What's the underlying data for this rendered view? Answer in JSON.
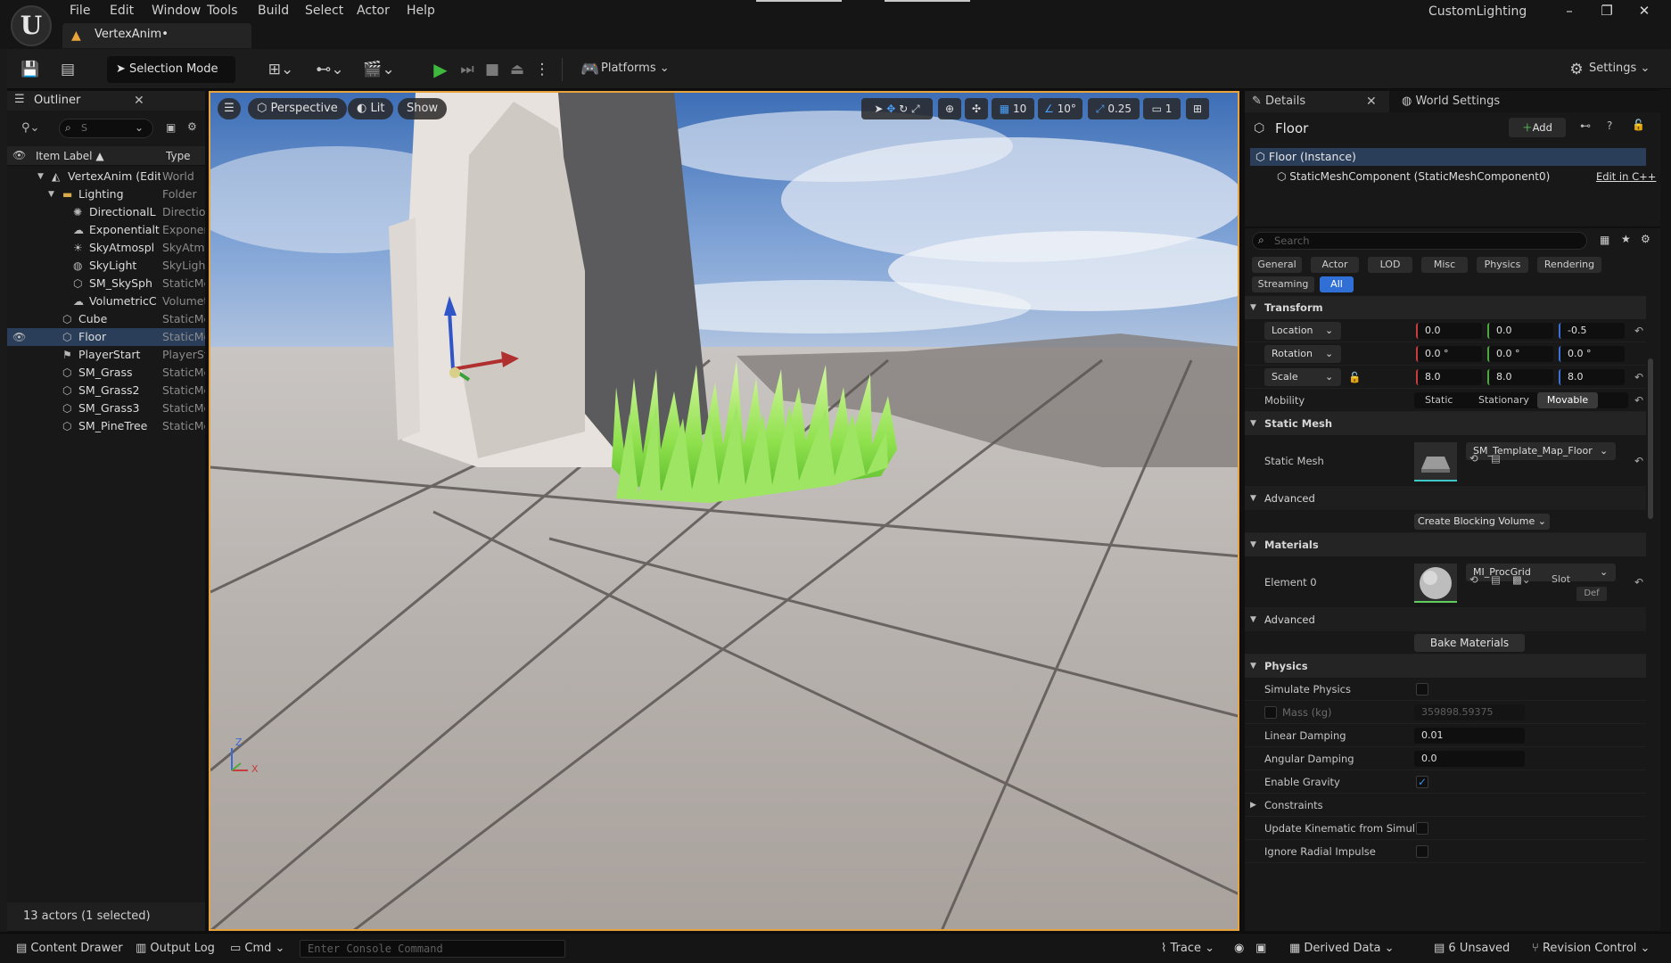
{
  "app": {
    "menu": [
      "File",
      "Edit",
      "Window",
      "Tools",
      "Build",
      "Select",
      "Actor",
      "Help"
    ],
    "document_tab": "VertexAnim•",
    "project_name": "CustomLighting",
    "window_buttons": [
      "–",
      "❐",
      "✕"
    ]
  },
  "toolbar": {
    "selection_mode": "Selection Mode",
    "platforms": "Platforms",
    "settings": "Settings"
  },
  "outliner": {
    "title": "Outliner",
    "search_value": "S",
    "col_label": "Item Label ▲",
    "col_type": "Type",
    "rows": [
      {
        "label": "VertexAnim (Edit",
        "type": "World",
        "icon": "◭",
        "indent": 0,
        "expanded": true,
        "selected": false
      },
      {
        "label": "Lighting",
        "type": "Folder",
        "icon": "▬",
        "indent": 1,
        "expanded": true,
        "selected": false
      },
      {
        "label": "DirectionalL",
        "type": "Directio",
        "icon": "✺",
        "indent": 2,
        "selected": false
      },
      {
        "label": "Exponentialt",
        "type": "Exponer",
        "icon": "☁",
        "indent": 2,
        "selected": false
      },
      {
        "label": "SkyAtmospl",
        "type": "SkyAtmo",
        "icon": "☀",
        "indent": 2,
        "selected": false
      },
      {
        "label": "SkyLight",
        "type": "SkyLigh",
        "icon": "◍",
        "indent": 2,
        "selected": false
      },
      {
        "label": "SM_SkySph",
        "type": "StaticMe",
        "icon": "⬡",
        "indent": 2,
        "selected": false
      },
      {
        "label": "VolumetricC",
        "type": "Volumet",
        "icon": "☁",
        "indent": 2,
        "selected": false
      },
      {
        "label": "Cube",
        "type": "StaticMe",
        "icon": "⬡",
        "indent": 1,
        "selected": false
      },
      {
        "label": "Floor",
        "type": "StaticMe",
        "icon": "⬡",
        "indent": 1,
        "selected": true
      },
      {
        "label": "PlayerStart",
        "type": "PlayerSt",
        "icon": "⚑",
        "indent": 1,
        "selected": false
      },
      {
        "label": "SM_Grass",
        "type": "StaticMe",
        "icon": "⬡",
        "indent": 1,
        "selected": false
      },
      {
        "label": "SM_Grass2",
        "type": "StaticMe",
        "icon": "⬡",
        "indent": 1,
        "selected": false
      },
      {
        "label": "SM_Grass3",
        "type": "StaticMe",
        "icon": "⬡",
        "indent": 1,
        "selected": false
      },
      {
        "label": "SM_PineTree",
        "type": "StaticMe",
        "icon": "⬡",
        "indent": 1,
        "selected": false
      }
    ],
    "footer": "13 actors (1 selected)"
  },
  "viewport": {
    "perspective": "Perspective",
    "lit": "Lit",
    "show": "Show",
    "grid_snap": "10",
    "rot_snap": "10°",
    "scale_snap": "0.25",
    "cam_speed": "1",
    "axis_z": "Z",
    "axis_x": "X"
  },
  "details": {
    "tab_details": "Details",
    "tab_world": "World Settings",
    "actor_name": "Floor",
    "add": "Add",
    "instance": "Floor (Instance)",
    "component": "StaticMeshComponent (StaticMeshComponent0)",
    "edit_cpp": "Edit in C++",
    "search_placeholder": "Search",
    "categories_row1": [
      "General",
      "Actor",
      "LOD",
      "Misc",
      "Physics",
      "Rendering"
    ],
    "categories_row2": [
      "Streaming",
      "All"
    ],
    "transform": {
      "title": "Transform",
      "location_label": "Location",
      "location": [
        "0.0",
        "0.0",
        "-0.5"
      ],
      "rotation_label": "Rotation",
      "rotation": [
        "0.0 °",
        "0.0 °",
        "0.0 °"
      ],
      "scale_label": "Scale",
      "scale": [
        "8.0",
        "8.0",
        "8.0"
      ],
      "mobility_label": "Mobility",
      "mobility_options": [
        "Static",
        "Stationary",
        "Movable"
      ]
    },
    "static_mesh": {
      "title": "Static Mesh",
      "label": "Static Mesh",
      "value": "SM_Template_Map_Floor",
      "advanced": "Advanced",
      "create_blocking": "Create Blocking Volume"
    },
    "materials": {
      "title": "Materials",
      "element0": "Element 0",
      "value": "MI_ProcGrid",
      "slot": "Slot",
      "slot_value": "Def",
      "advanced": "Advanced",
      "bake": "Bake Materials"
    },
    "physics": {
      "title": "Physics",
      "simulate": "Simulate Physics",
      "mass": "Mass (kg)",
      "mass_value": "359898.59375",
      "linear": "Linear Damping",
      "linear_value": "0.01",
      "angular": "Angular Damping",
      "angular_value": "0.0",
      "gravity": "Enable Gravity",
      "constraints": "Constraints",
      "update_kinematic": "Update Kinematic from Simul...",
      "ignore_radial": "Ignore Radial Impulse"
    }
  },
  "statusbar": {
    "content_drawer": "Content Drawer",
    "output_log": "Output Log",
    "cmd": "Cmd",
    "console_placeholder": "Enter Console Command",
    "trace": "Trace",
    "derived_data": "Derived Data",
    "unsaved": "6 Unsaved",
    "revision": "Revision Control"
  }
}
